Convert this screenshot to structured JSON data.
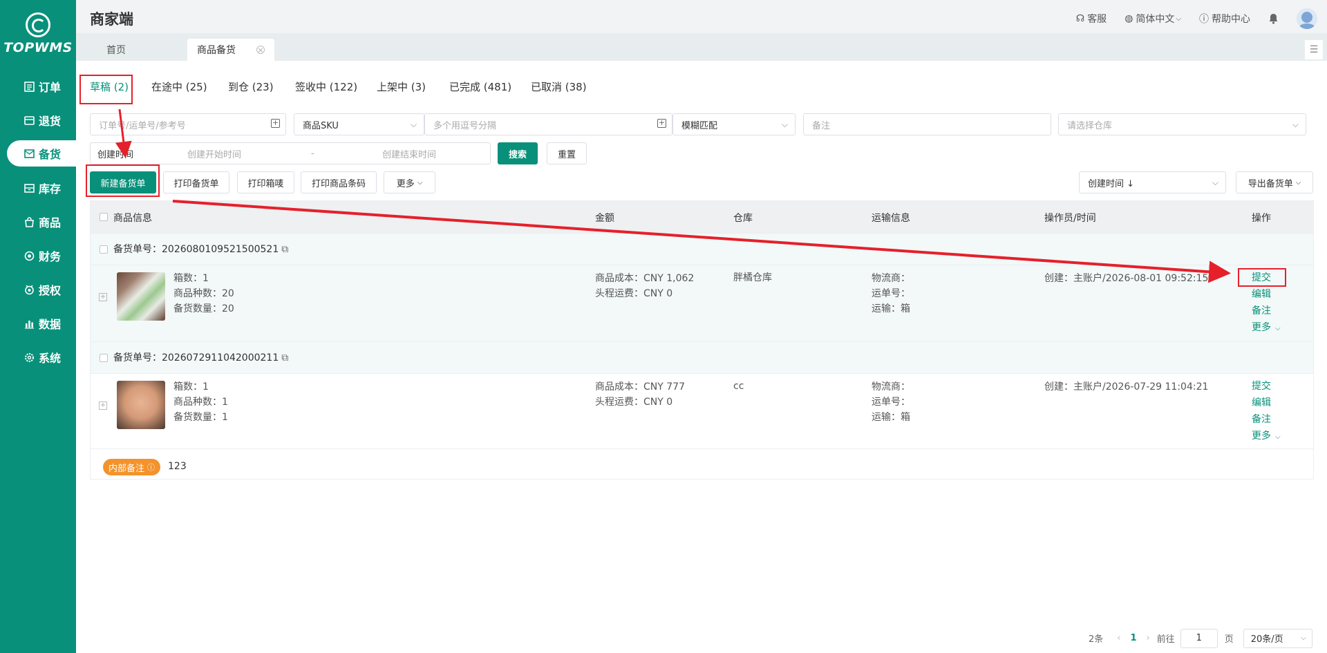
{
  "app": {
    "logo_text": "TOPWMS",
    "brand": "商家端"
  },
  "sidebar": {
    "items": [
      {
        "label": "订单",
        "icon": "list-icon"
      },
      {
        "label": "退货",
        "icon": "return-icon"
      },
      {
        "label": "备货",
        "icon": "mail-icon",
        "active": true
      },
      {
        "label": "库存",
        "icon": "inventory-icon"
      },
      {
        "label": "商品",
        "icon": "bag-icon"
      },
      {
        "label": "财务",
        "icon": "finance-icon"
      },
      {
        "label": "授权",
        "icon": "auth-icon"
      },
      {
        "label": "数据",
        "icon": "chart-icon"
      },
      {
        "label": "系统",
        "icon": "gear-icon"
      }
    ]
  },
  "header": {
    "service": "客服",
    "language": "简体中文",
    "help": "帮助中心"
  },
  "page_tabs": [
    "首页",
    "商品备货"
  ],
  "status_tabs": [
    "草稿 (2)",
    "在途中 (25)",
    "到仓 (23)",
    "签收中 (122)",
    "上架中 (3)",
    "已完成 (481)",
    "已取消 (38)"
  ],
  "filters": {
    "order_placeholder": "订单号/运单号/参考号",
    "sku_type": "商品SKU",
    "sku_placeholder": "多个用逗号分隔",
    "match_mode": "模糊匹配",
    "remark_placeholder": "备注",
    "warehouse_placeholder": "请选择仓库",
    "time_type": "创建时间",
    "start_placeholder": "创建开始时间",
    "range_sep": "-",
    "end_placeholder": "创建结束时间",
    "search_label": "搜索",
    "reset_label": "重置"
  },
  "toolbar": {
    "new_label": "新建备货单",
    "print_order": "打印备货单",
    "print_box": "打印箱唛",
    "print_barcode": "打印商品条码",
    "more": "更多",
    "sort": "创建时间 ↓",
    "export": "导出备货单"
  },
  "table": {
    "headers": [
      "商品信息",
      "金额",
      "仓库",
      "运输信息",
      "操作员/时间",
      "操作"
    ],
    "rows": [
      {
        "order_label": "备货单号：",
        "order_no": "2026080109521500521",
        "boxes": "箱数：1",
        "kinds": "商品种数：20",
        "qty": "备货数量：20",
        "cost": "商品成本：CNY 1,062",
        "freight": "头程运费：CNY 0",
        "warehouse": "胖橘仓库",
        "carrier": "物流商：",
        "waybill": "运单号：",
        "transport": "运输：箱",
        "creator": "创建：主账户/2026-08-01 09:52:15"
      },
      {
        "order_label": "备货单号：",
        "order_no": "2026072911042000211",
        "boxes": "箱数：1",
        "kinds": "商品种数：1",
        "qty": "备货数量：1",
        "cost": "商品成本：CNY 777",
        "freight": "头程运费：CNY 0",
        "warehouse": "cc",
        "carrier": "物流商：",
        "waybill": "运单号：",
        "transport": "运输：箱",
        "creator": "创建：主账户/2026-07-29 11:04:21"
      }
    ],
    "actions": [
      "提交",
      "编辑",
      "备注",
      "更多"
    ],
    "note_badge": "内部备注",
    "note_text": "123"
  },
  "pager": {
    "total": "2条",
    "current": "1",
    "goto": "前往",
    "page_input": "1",
    "page_unit": "页",
    "size": "20条/页"
  },
  "colors": {
    "primary": "#08907a",
    "annotation": "#e5202a",
    "badge": "#f4922b"
  }
}
